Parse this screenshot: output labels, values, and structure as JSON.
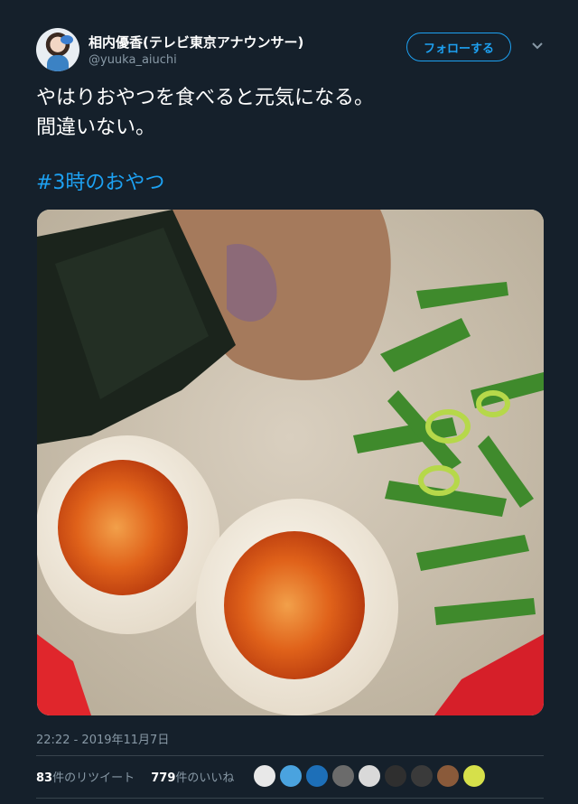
{
  "user": {
    "display_name": "相内優香(テレビ東京アナウンサー)",
    "handle": "@yuuka_aiuchi",
    "follow_label": "フォローする"
  },
  "tweet": {
    "lines": [
      "やはりおやつを食べると元気になる。",
      "間違いない。"
    ],
    "hashtag": "#3時のおやつ",
    "timestamp": "22:22 - 2019年11月7日"
  },
  "stats": {
    "retweets_count": "83",
    "retweets_label": "件のリツイート",
    "likes_count": "779",
    "likes_label": "件のいいね"
  },
  "likers": [
    {
      "color": "#e8e8e8"
    },
    {
      "color": "#4aa3df"
    },
    {
      "color": "#1d6fb8"
    },
    {
      "color": "#6b6b6b"
    },
    {
      "color": "#d9d9d9"
    },
    {
      "color": "#2f2f2f"
    },
    {
      "color": "#3a3a3a"
    },
    {
      "color": "#8a5a3a"
    },
    {
      "color": "#d6e04a"
    }
  ],
  "colors": {
    "background": "#15202b",
    "accent": "#1da1f2",
    "secondary_text": "#8899a6",
    "divider": "#38444d"
  },
  "icons": {
    "more": "chevron-down-icon"
  }
}
